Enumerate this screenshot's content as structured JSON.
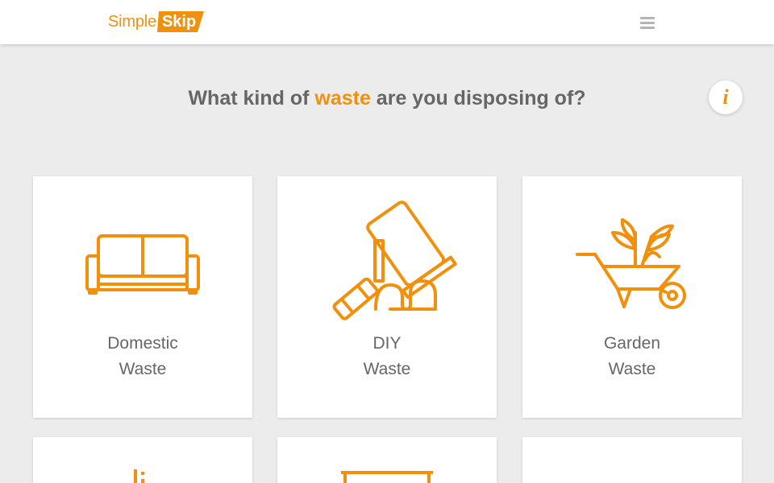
{
  "header": {
    "logo_simple": "Simple",
    "logo_skip": "Skip",
    "menu_icon": "hamburger-menu-icon"
  },
  "question": {
    "before": "What kind of ",
    "highlight": "waste",
    "after": " are you disposing of?"
  },
  "info_button": {
    "label": "i",
    "icon": "info-icon"
  },
  "cards": [
    {
      "line1": "Domestic",
      "line2": "Waste",
      "icon": "sofa-icon"
    },
    {
      "line1": "DIY",
      "line2": "Waste",
      "icon": "paint-roller-icon"
    },
    {
      "line1": "Garden",
      "line2": "Waste",
      "icon": "wheelbarrow-plant-icon"
    },
    {
      "line1": "",
      "line2": "",
      "icon": "bricks-icon"
    },
    {
      "line1": "",
      "line2": "",
      "icon": "table-icon"
    },
    {
      "line1": "",
      "line2": "",
      "icon": ""
    }
  ],
  "colors": {
    "accent": "#f0900c",
    "text": "#666666",
    "background": "#ececec",
    "card": "#ffffff"
  }
}
